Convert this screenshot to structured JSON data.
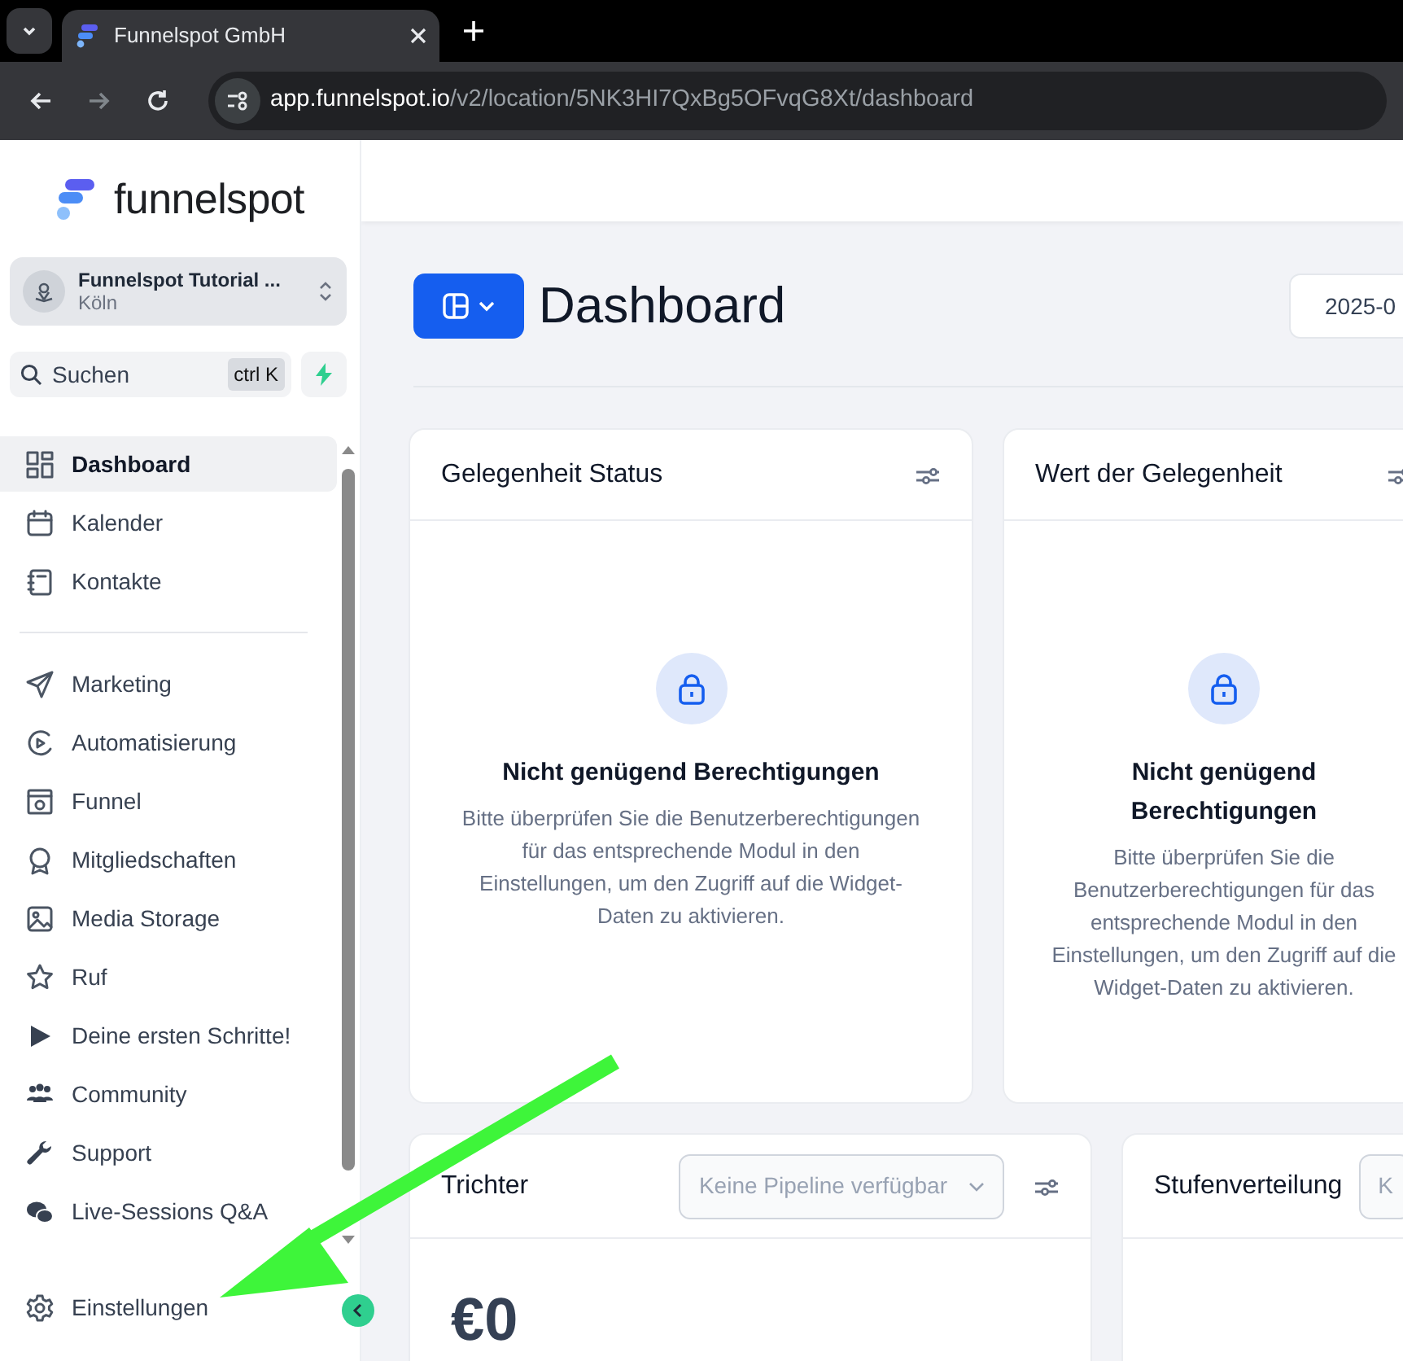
{
  "browser": {
    "tab_title": "Funnelspot GmbH",
    "url_host": "app.funnelspot.io",
    "url_path": "/v2/location/5NK3HI7QxBg5OFvqG8Xt/dashboard"
  },
  "sidebar": {
    "logo_text": "funnelspot",
    "account": {
      "name": "Funnelspot Tutorial ...",
      "location": "Köln"
    },
    "search": {
      "placeholder": "Suchen",
      "shortcut": "ctrl K"
    },
    "groups": [
      {
        "items": [
          {
            "label": "Dashboard",
            "kind": "grid",
            "selected": true
          },
          {
            "label": "Kalender",
            "kind": "calendar",
            "selected": false
          },
          {
            "label": "Kontakte",
            "kind": "book",
            "selected": false
          }
        ]
      },
      {
        "items": [
          {
            "label": "Marketing",
            "kind": "send",
            "selected": false
          },
          {
            "label": "Automatisierung",
            "kind": "play-circle",
            "selected": false
          },
          {
            "label": "Funnel",
            "kind": "window",
            "selected": false
          },
          {
            "label": "Mitgliedschaften",
            "kind": "award",
            "selected": false
          },
          {
            "label": "Media Storage",
            "kind": "image",
            "selected": false
          },
          {
            "label": "Ruf",
            "kind": "star",
            "selected": false
          },
          {
            "label": "Deine ersten Schritte!",
            "kind": "play",
            "selected": false
          },
          {
            "label": "Community",
            "kind": "people",
            "selected": false
          },
          {
            "label": "Support",
            "kind": "wrench",
            "selected": false
          },
          {
            "label": "Live-Sessions Q&A",
            "kind": "chat",
            "selected": false
          }
        ]
      }
    ],
    "footer_item": {
      "label": "Einstellungen",
      "kind": "gear",
      "selected": false
    }
  },
  "main": {
    "page_title": "Dashboard",
    "date_field": "2025-0",
    "widgets": [
      {
        "kind": "locked",
        "title": "Gelegenheit Status",
        "message_title": "Nicht genügend Berechtigungen",
        "message": "Bitte überprüfen Sie die Benutzerberechtigungen für das entsprechende Modul in den Einstellungen, um den Zugriff auf die Widget-Daten zu aktivieren."
      },
      {
        "kind": "locked",
        "title": "Wert der Gelegenheit",
        "message_title": "Nicht genügend Berechtigungen",
        "message": "Bitte überprüfen Sie die Benutzerberechtigungen für das entsprechende Modul in den Einstellungen, um den Zugriff auf die Widget-Daten zu aktivieren."
      },
      {
        "kind": "pipeline",
        "title": "Trichter",
        "select_placeholder": "Keine Pipeline verfügbar",
        "value": "€0"
      },
      {
        "kind": "pipeline",
        "title": "Stufenverteilung",
        "select_placeholder": "K"
      }
    ]
  }
}
